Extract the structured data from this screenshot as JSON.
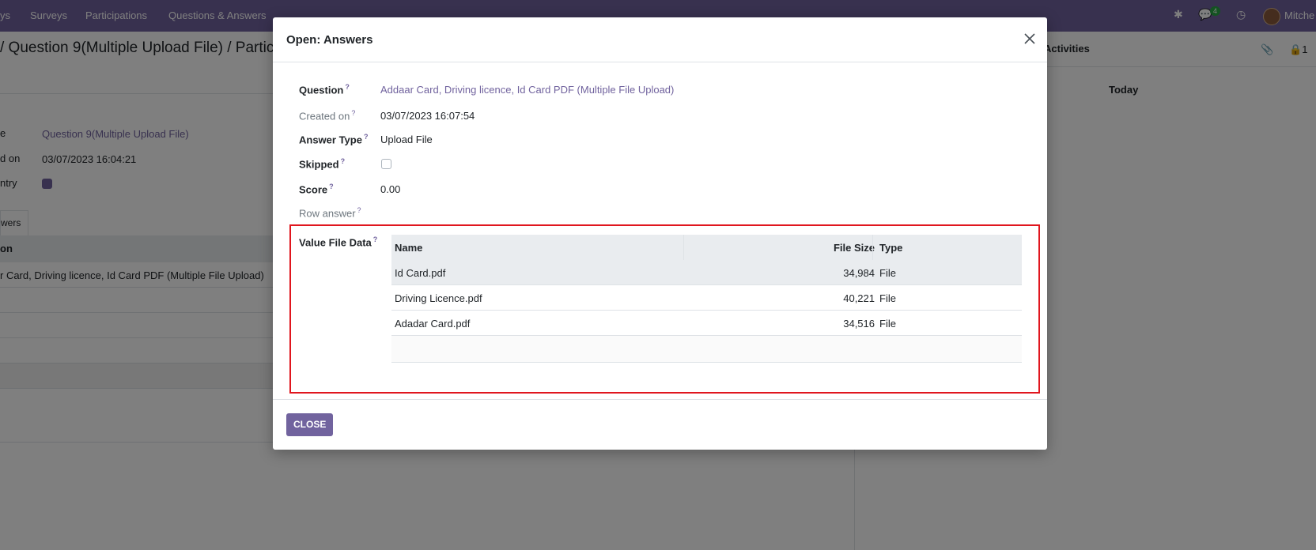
{
  "navbar": {
    "app_fragment": "ys",
    "menu": [
      "Surveys",
      "Participations",
      "Questions & Answers"
    ],
    "message_count": "4",
    "user_fragment": "Mitche"
  },
  "background": {
    "breadcrumb": "/ Question 9(Multiple Upload File) / Partici",
    "fields": [
      {
        "label": "e",
        "value": "Question 9(Multiple Upload File)"
      },
      {
        "label": "d on",
        "value": "03/07/2023 16:04:21"
      },
      {
        "label": "ntry",
        "value": ""
      }
    ],
    "tab_label": "wers",
    "table_header": "on",
    "table_row": "r Card, Driving licence, Id Card PDF (Multiple File Upload)",
    "chatter": {
      "activities": "Activities",
      "today": "Today",
      "followers": "1"
    }
  },
  "modal": {
    "title": "Open: Answers",
    "fields": {
      "question": {
        "label": "Question",
        "value": "Addaar Card, Driving licence, Id Card PDF (Multiple File Upload)"
      },
      "created_on": {
        "label": "Created on",
        "value": "03/07/2023 16:07:54"
      },
      "answer_type": {
        "label": "Answer Type",
        "value": "Upload File"
      },
      "skipped": {
        "label": "Skipped",
        "checked": false
      },
      "score": {
        "label": "Score",
        "value": "0.00"
      },
      "row_answer": {
        "label": "Row answer",
        "value": ""
      },
      "value_file_data": {
        "label": "Value File Data"
      }
    },
    "file_table": {
      "columns": [
        "Name",
        "File Size",
        "Type"
      ],
      "rows": [
        {
          "name": "Id Card.pdf",
          "size": "34,984",
          "type": "File"
        },
        {
          "name": "Driving Licence.pdf",
          "size": "40,221",
          "type": "File"
        },
        {
          "name": "Adadar Card.pdf",
          "size": "34,516",
          "type": "File"
        }
      ]
    },
    "help_mark": "?",
    "close_button": "CLOSE",
    "highlight_color": "#e0161e"
  },
  "colors": {
    "brand": "#71639e",
    "overlay": "rgba(0,0,0,0.5)"
  }
}
